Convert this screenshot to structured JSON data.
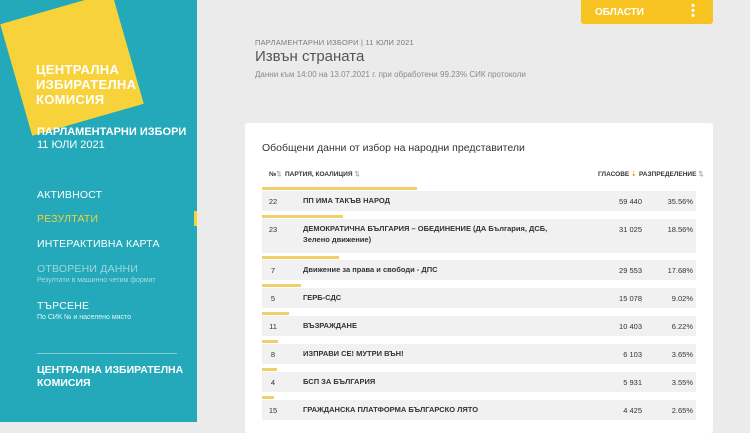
{
  "sidebar": {
    "logo_lines": [
      "ЦЕНТРАЛНА",
      "ИЗБИРАТЕЛНА",
      "КОМИСИЯ"
    ],
    "election_title": "ПАРЛАМЕНТАРНИ ИЗБОРИ",
    "election_date": "11 ЮЛИ 2021",
    "nav": [
      {
        "label": "АКТИВНОСТ",
        "sub": "",
        "state": "normal"
      },
      {
        "label": "РЕЗУЛТАТИ",
        "sub": "",
        "state": "active"
      },
      {
        "label": "ИНТЕРАКТИВНА КАРТА",
        "sub": "",
        "state": "normal"
      },
      {
        "label": "ОТВОРЕНИ ДАННИ",
        "sub": "Резултати в машинно четим формат",
        "state": "disabled"
      },
      {
        "label": "ТЪРСЕНЕ",
        "sub": "По СИК № и населено място",
        "state": "normal"
      }
    ],
    "footer_lines": [
      "ЦЕНТРАЛНА ИЗБИРАТЕЛНА",
      "КОМИСИЯ"
    ]
  },
  "header": {
    "breadcrumb": "ПАРЛАМЕНТАРНИ ИЗБОРИ | 11 ЮЛИ 2021",
    "title": "Извън страната",
    "data_info": "Данни към 14:00 на 13.07.2021 г. при обработени 99.23% СИК протоколи",
    "regions_button": "ОБЛАСТИ"
  },
  "results": {
    "title": "Обобщени данни от избор на народни представители",
    "columns": {
      "num": "№",
      "party": "ПАРТИЯ, КОАЛИЦИЯ",
      "votes": "ГЛАСОВЕ",
      "distribution": "РАЗПРЕДЕЛЕНИЕ"
    },
    "rows": [
      {
        "num": "22",
        "party": "ПП ИМА ТАКЪВ НАРОД",
        "votes": "59 440",
        "pct": "35.56%",
        "share": 35.56
      },
      {
        "num": "23",
        "party": "ДЕМОКРАТИЧНА БЪЛГАРИЯ – ОБЕДИНЕНИЕ (ДА България, ДСБ, Зелено движение)",
        "votes": "31 025",
        "pct": "18.56%",
        "share": 18.56
      },
      {
        "num": "7",
        "party": "Движение за права и свободи - ДПС",
        "votes": "29 553",
        "pct": "17.68%",
        "share": 17.68
      },
      {
        "num": "5",
        "party": "ГЕРБ-СДС",
        "votes": "15 078",
        "pct": "9.02%",
        "share": 9.02
      },
      {
        "num": "11",
        "party": "ВЪЗРАЖДАНЕ",
        "votes": "10 403",
        "pct": "6.22%",
        "share": 6.22
      },
      {
        "num": "8",
        "party": "ИЗПРАВИ СЕ! МУТРИ ВЪН!",
        "votes": "6 103",
        "pct": "3.65%",
        "share": 3.65
      },
      {
        "num": "4",
        "party": "БСП ЗА БЪЛГАРИЯ",
        "votes": "5 931",
        "pct": "3.55%",
        "share": 3.55
      },
      {
        "num": "15",
        "party": "ГРАЖДАНСКА ПЛАТФОРМА БЪЛГАРСКО ЛЯТО",
        "votes": "4 425",
        "pct": "2.65%",
        "share": 2.65
      }
    ]
  },
  "colors": {
    "sidebar": "#23a9b9",
    "accent": "#f7d23a",
    "button": "#f7c321",
    "bar": "#f2cf6b"
  }
}
